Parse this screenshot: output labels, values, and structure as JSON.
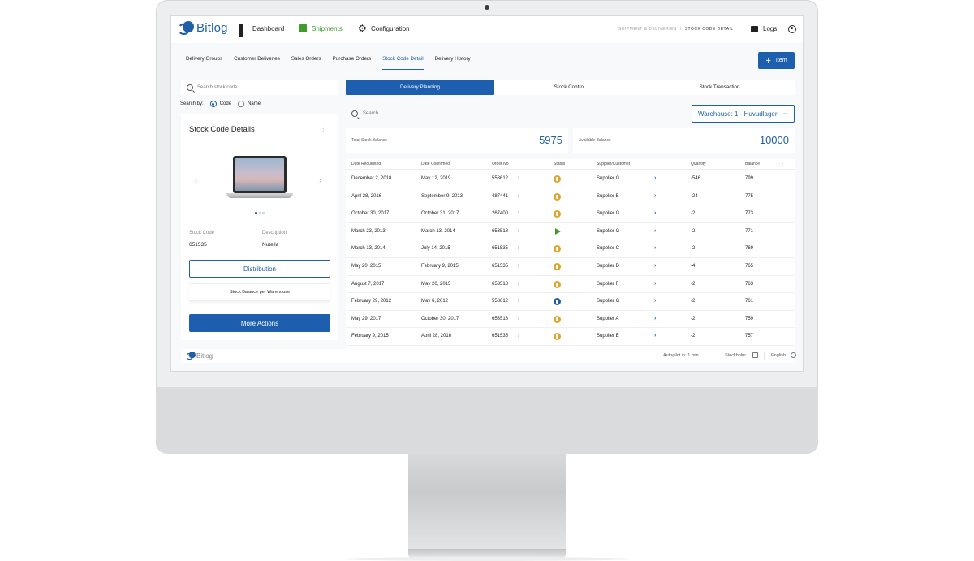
{
  "nav": {
    "brand": "Bitlog",
    "dashboard": "Dashboard",
    "shipments": "Shipments",
    "configuration": "Configuration",
    "breadcrumb_parent": "SHIPMENT & DELIVERIES",
    "breadcrumb_sep": "/",
    "breadcrumb_current": "STOCK CODE DETAIL",
    "logs": "Logs"
  },
  "tabs": [
    "Delivery Groups",
    "Customer Deliveries",
    "Sales Orders",
    "Purchase Orders",
    "Stock Code Detail",
    "Delivery History"
  ],
  "active_tab": "Stock Code Detail",
  "add_button": {
    "icon": "+",
    "label": "Item"
  },
  "left": {
    "search_placeholder": "Search stock code",
    "search_by_label": "Search by:",
    "search_by_options": [
      "Code",
      "Name"
    ],
    "search_by_selected": "Code",
    "card_title": "Stock Code Details",
    "stock_code_label": "Stock Code",
    "stock_code_value": "651535",
    "description_label": "Description",
    "description_value": "Nutella",
    "distribution_button": "Distribution",
    "stock_balance_label": "Stock Balance per Warehouse",
    "more_actions_button": "More Actions"
  },
  "right": {
    "segments": [
      "Delivery Planning",
      "Stock Control",
      "Stock Transaction"
    ],
    "active_segment": "Delivery Planning",
    "search_placeholder": "Search",
    "warehouse_select": "Warehouse: 1 - Huvudlager",
    "total_stock_label": "Total Stock Balance",
    "total_stock_value": "5975",
    "available_label": "Available Balance",
    "available_value": "10000"
  },
  "table": {
    "headers": [
      "Date Requested",
      "Date Confirmed",
      "Order No",
      "Status",
      "Supplier/Customer",
      "Quantity",
      "Balance"
    ],
    "rows": [
      {
        "req": "December 2, 2018",
        "conf": "May 12, 2019",
        "order": "558612",
        "status": "yellow",
        "supplier": "Supplier G",
        "qty": "-546",
        "bal": "799"
      },
      {
        "req": "April 28, 2016",
        "conf": "September 9, 2013",
        "order": "487441",
        "status": "yellow",
        "supplier": "Supplier B",
        "qty": "-24",
        "bal": "775"
      },
      {
        "req": "October 30, 2017",
        "conf": "October 31, 2017",
        "order": "267400",
        "status": "yellow",
        "supplier": "Supplier G",
        "qty": "-2",
        "bal": "773"
      },
      {
        "req": "March 23, 2013",
        "conf": "March 13, 2014",
        "order": "653518",
        "status": "green",
        "supplier": "Supplier G",
        "qty": "-2",
        "bal": "771"
      },
      {
        "req": "March 13, 2014",
        "conf": "July 14, 2015",
        "order": "651535",
        "status": "yellow",
        "supplier": "Supplier C",
        "qty": "-2",
        "bal": "769"
      },
      {
        "req": "May 20, 2015",
        "conf": "February 9, 2015",
        "order": "651535",
        "status": "yellow",
        "supplier": "Supplier D",
        "qty": "-4",
        "bal": "765"
      },
      {
        "req": "August 7, 2017",
        "conf": "May 20, 2015",
        "order": "653518",
        "status": "yellow",
        "supplier": "Supplier F",
        "qty": "-2",
        "bal": "763"
      },
      {
        "req": "February 29, 2012",
        "conf": "May 6, 2012",
        "order": "558612",
        "status": "blue",
        "supplier": "Supplier G",
        "qty": "-2",
        "bal": "761"
      },
      {
        "req": "May 29, 2017",
        "conf": "October 30, 2017",
        "order": "653518",
        "status": "yellow",
        "supplier": "Supplier A",
        "qty": "-2",
        "bal": "759"
      },
      {
        "req": "February 9, 2015",
        "conf": "April 28, 2016",
        "order": "651535",
        "status": "yellow",
        "supplier": "Supplier E",
        "qty": "-2",
        "bal": "757"
      }
    ]
  },
  "footer": {
    "brand": "Bitlog",
    "autopilot": "Autopilot in: 1 min",
    "location": "Stockholm",
    "language": "English"
  },
  "colors": {
    "primary": "#1d5fae",
    "shipments_green": "#3f9b2b",
    "status_yellow": "#e0a526",
    "status_green": "#3f9b2b",
    "status_blue": "#1f5fa8"
  }
}
